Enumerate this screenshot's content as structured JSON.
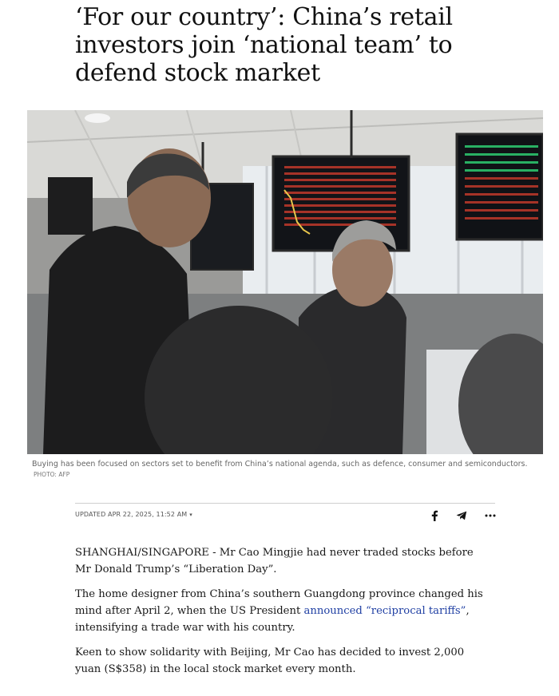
{
  "article": {
    "headline": "‘For our country’: China’s retail investors join ‘national team’ to defend stock market",
    "photo": {
      "alt": "Two elderly men speaking in a brokerage hall with stock price screens behind them",
      "caption": "Buying has been focused on sectors set to benefit from China’s national agenda, such as defence, consumer and semiconductors.",
      "credit": "PHOTO: AFP"
    },
    "meta": {
      "updated": "UPDATED APR 22, 2025, 11:52 AM",
      "caret": "▾"
    },
    "share": {
      "facebook_icon": "facebook-icon",
      "telegram_icon": "telegram-icon",
      "more_icon": "more-icon"
    },
    "paragraphs": {
      "p1": "SHANGHAI/SINGAPORE - Mr Cao Mingjie had never traded stocks before Mr Donald Trump’s “Liberation Day”.",
      "p2_before": "The home designer from China’s southern Guangdong province changed his mind after April 2, when the US President ",
      "p2_link": "announced “reciprocal tariffs”",
      "p2_after": ", intensifying a trade war with his country.",
      "p3": "Keen to show solidarity with Beijing, Mr Cao has decided to invest 2,000 yuan (S$358) in the local stock market every month."
    }
  }
}
